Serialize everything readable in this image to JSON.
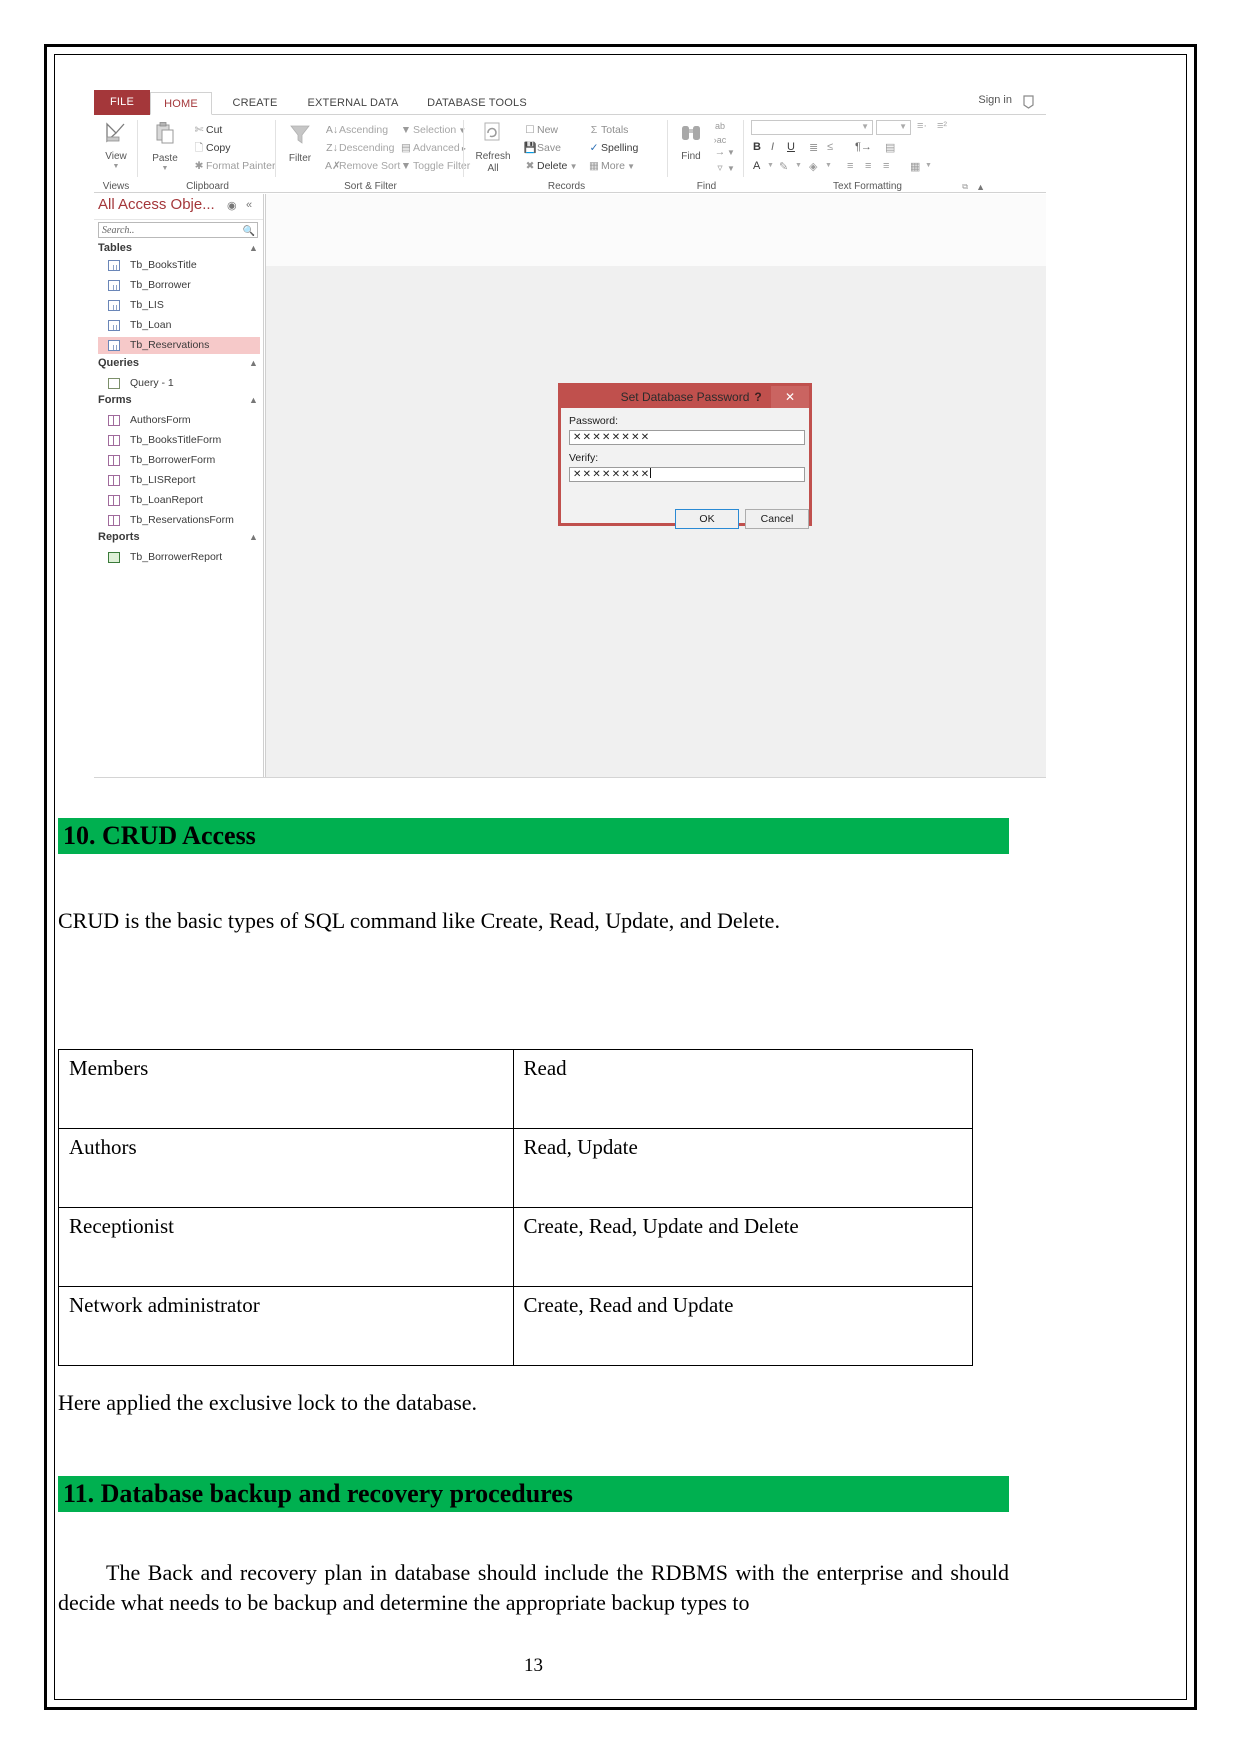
{
  "access_window": {
    "tabs": [
      {
        "label": "FILE",
        "name": "tab-file"
      },
      {
        "label": "HOME",
        "name": "tab-home"
      },
      {
        "label": "CREATE",
        "name": "tab-create"
      },
      {
        "label": "EXTERNAL DATA",
        "name": "tab-external-data"
      },
      {
        "label": "DATABASE TOOLS",
        "name": "tab-database-tools"
      }
    ],
    "sign_in": "Sign in",
    "ribbon": {
      "groups": [
        {
          "label": "Views"
        },
        {
          "label": "Clipboard"
        },
        {
          "label": "Sort & Filter"
        },
        {
          "label": "Records"
        },
        {
          "label": "Find"
        },
        {
          "label": "Text Formatting"
        }
      ],
      "views": {
        "big_label": "View"
      },
      "clipboard": {
        "paste": "Paste",
        "cut": "Cut",
        "copy": "Copy",
        "format_painter": "Format Painter"
      },
      "sort_filter": {
        "filter": "Filter",
        "ascending": "Ascending",
        "descending": "Descending",
        "remove_sort": "Remove Sort",
        "selection": "Selection",
        "advanced": "Advanced",
        "toggle_filter": "Toggle Filter"
      },
      "records": {
        "refresh_all": "Refresh\nAll",
        "refresh_line1": "Refresh",
        "refresh_line2": "All",
        "new": "New",
        "save": "Save",
        "delete": "Delete",
        "totals": "Totals",
        "spelling": "Spelling",
        "more": "More"
      },
      "find": {
        "find": "Find",
        "replace_icon": "replace-icon",
        "goto_icon": "goto-icon",
        "select_icon": "select-icon"
      },
      "text_formatting": {
        "bold": "B",
        "italic": "I",
        "underline": "U",
        "font_color": "A"
      }
    },
    "nav_pane": {
      "title": "All Access Obje...",
      "search_placeholder": "Search..",
      "groups": [
        {
          "label": "Tables",
          "icon": "table-icon",
          "items": [
            {
              "label": "Tb_BooksTitle",
              "selected": false
            },
            {
              "label": "Tb_Borrower",
              "selected": false
            },
            {
              "label": "Tb_LIS",
              "selected": false
            },
            {
              "label": "Tb_Loan",
              "selected": false
            },
            {
              "label": "Tb_Reservations",
              "selected": true
            }
          ]
        },
        {
          "label": "Queries",
          "icon": "query-icon",
          "items": [
            {
              "label": "Query - 1",
              "selected": false
            }
          ]
        },
        {
          "label": "Forms",
          "icon": "form-icon",
          "items": [
            {
              "label": "AuthorsForm",
              "selected": false
            },
            {
              "label": "Tb_BooksTitleForm",
              "selected": false
            },
            {
              "label": "Tb_BorrowerForm",
              "selected": false
            },
            {
              "label": "Tb_LISReport",
              "selected": false
            },
            {
              "label": "Tb_LoanReport",
              "selected": false
            },
            {
              "label": "Tb_ReservationsForm",
              "selected": false
            }
          ]
        },
        {
          "label": "Reports",
          "icon": "report-icon",
          "items": [
            {
              "label": "Tb_BorrowerReport",
              "selected": false
            }
          ]
        }
      ]
    },
    "dialog": {
      "title": "Set Database Password",
      "help_glyph": "?",
      "close_glyph": "✕",
      "password_label": "Password:",
      "password_value": "✕✕✕✕✕✕✕✕",
      "verify_label": "Verify:",
      "verify_value": "✕✕✕✕✕✕✕✕",
      "ok_label": "OK",
      "cancel_label": "Cancel"
    }
  },
  "document": {
    "heading_10": "10. CRUD Access",
    "intro": "CRUD is the basic types of SQL command like Create, Read, Update, and Delete.",
    "crud_table": {
      "rows": [
        {
          "role": "Members",
          "operations": "Read"
        },
        {
          "role": "Authors",
          "operations": "Read, Update"
        },
        {
          "role": "Receptionist",
          "operations": "Create, Read, Update and Delete"
        },
        {
          "role": "Network administrator",
          "operations": "Create, Read and Update"
        }
      ]
    },
    "lock_note": "Here applied the exclusive lock to the database.",
    "heading_11": "11. Database backup and recovery procedures",
    "backup_paragraph": "The Back and recovery plan in database should include the RDBMS with the enterprise and should decide what needs to be backup and determine the appropriate backup types to",
    "page_number": "13"
  },
  "colors": {
    "heading_highlight": "#00b050",
    "access_accent": "#a4373a",
    "dialog_border": "#c0504d",
    "selected_row": "#f6c9c9"
  }
}
